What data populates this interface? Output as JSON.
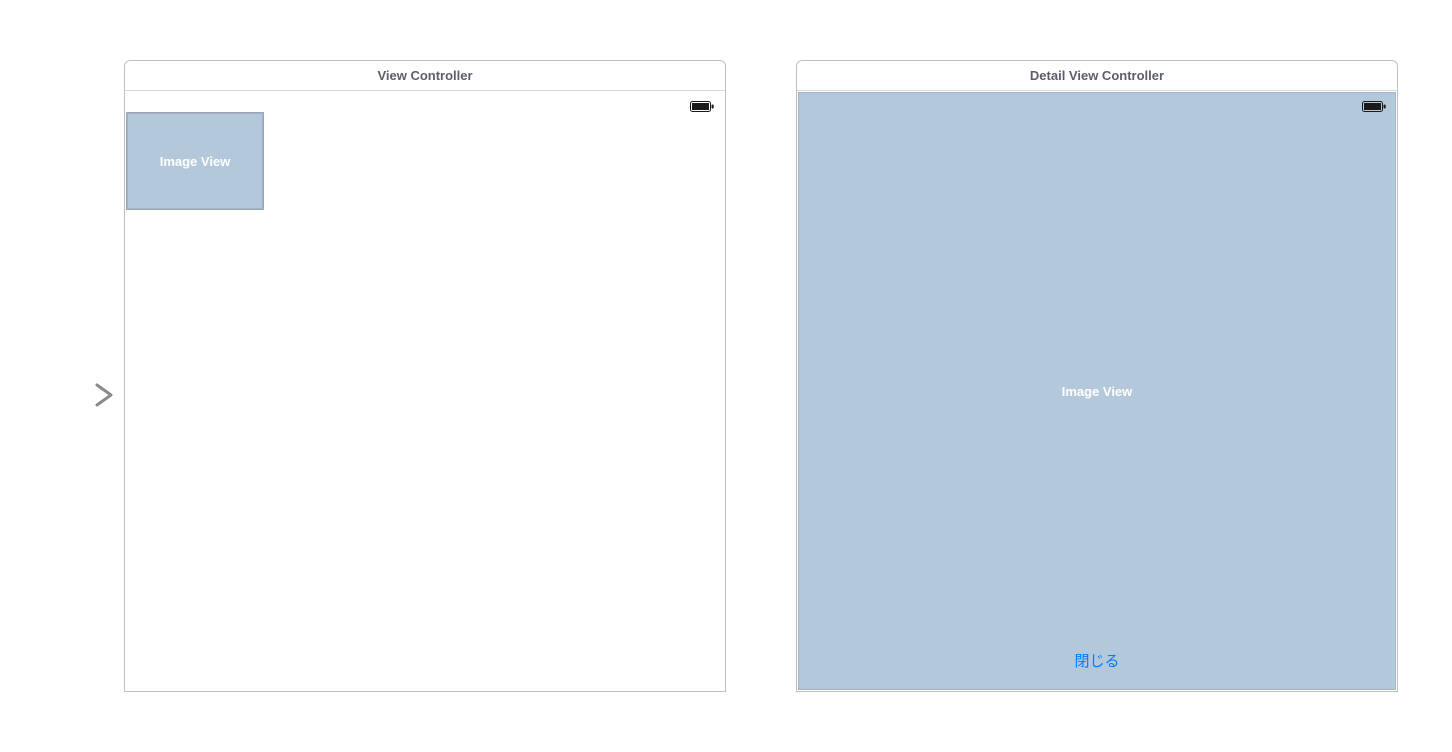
{
  "scenes": {
    "left": {
      "title": "View Controller",
      "image_view_label": "Image View"
    },
    "right": {
      "title": "Detail View Controller",
      "image_view_label": "Image View",
      "close_button_label": "閉じる"
    }
  },
  "colors": {
    "placeholder_bg": "#b4c8dc",
    "link": "#007aff"
  }
}
